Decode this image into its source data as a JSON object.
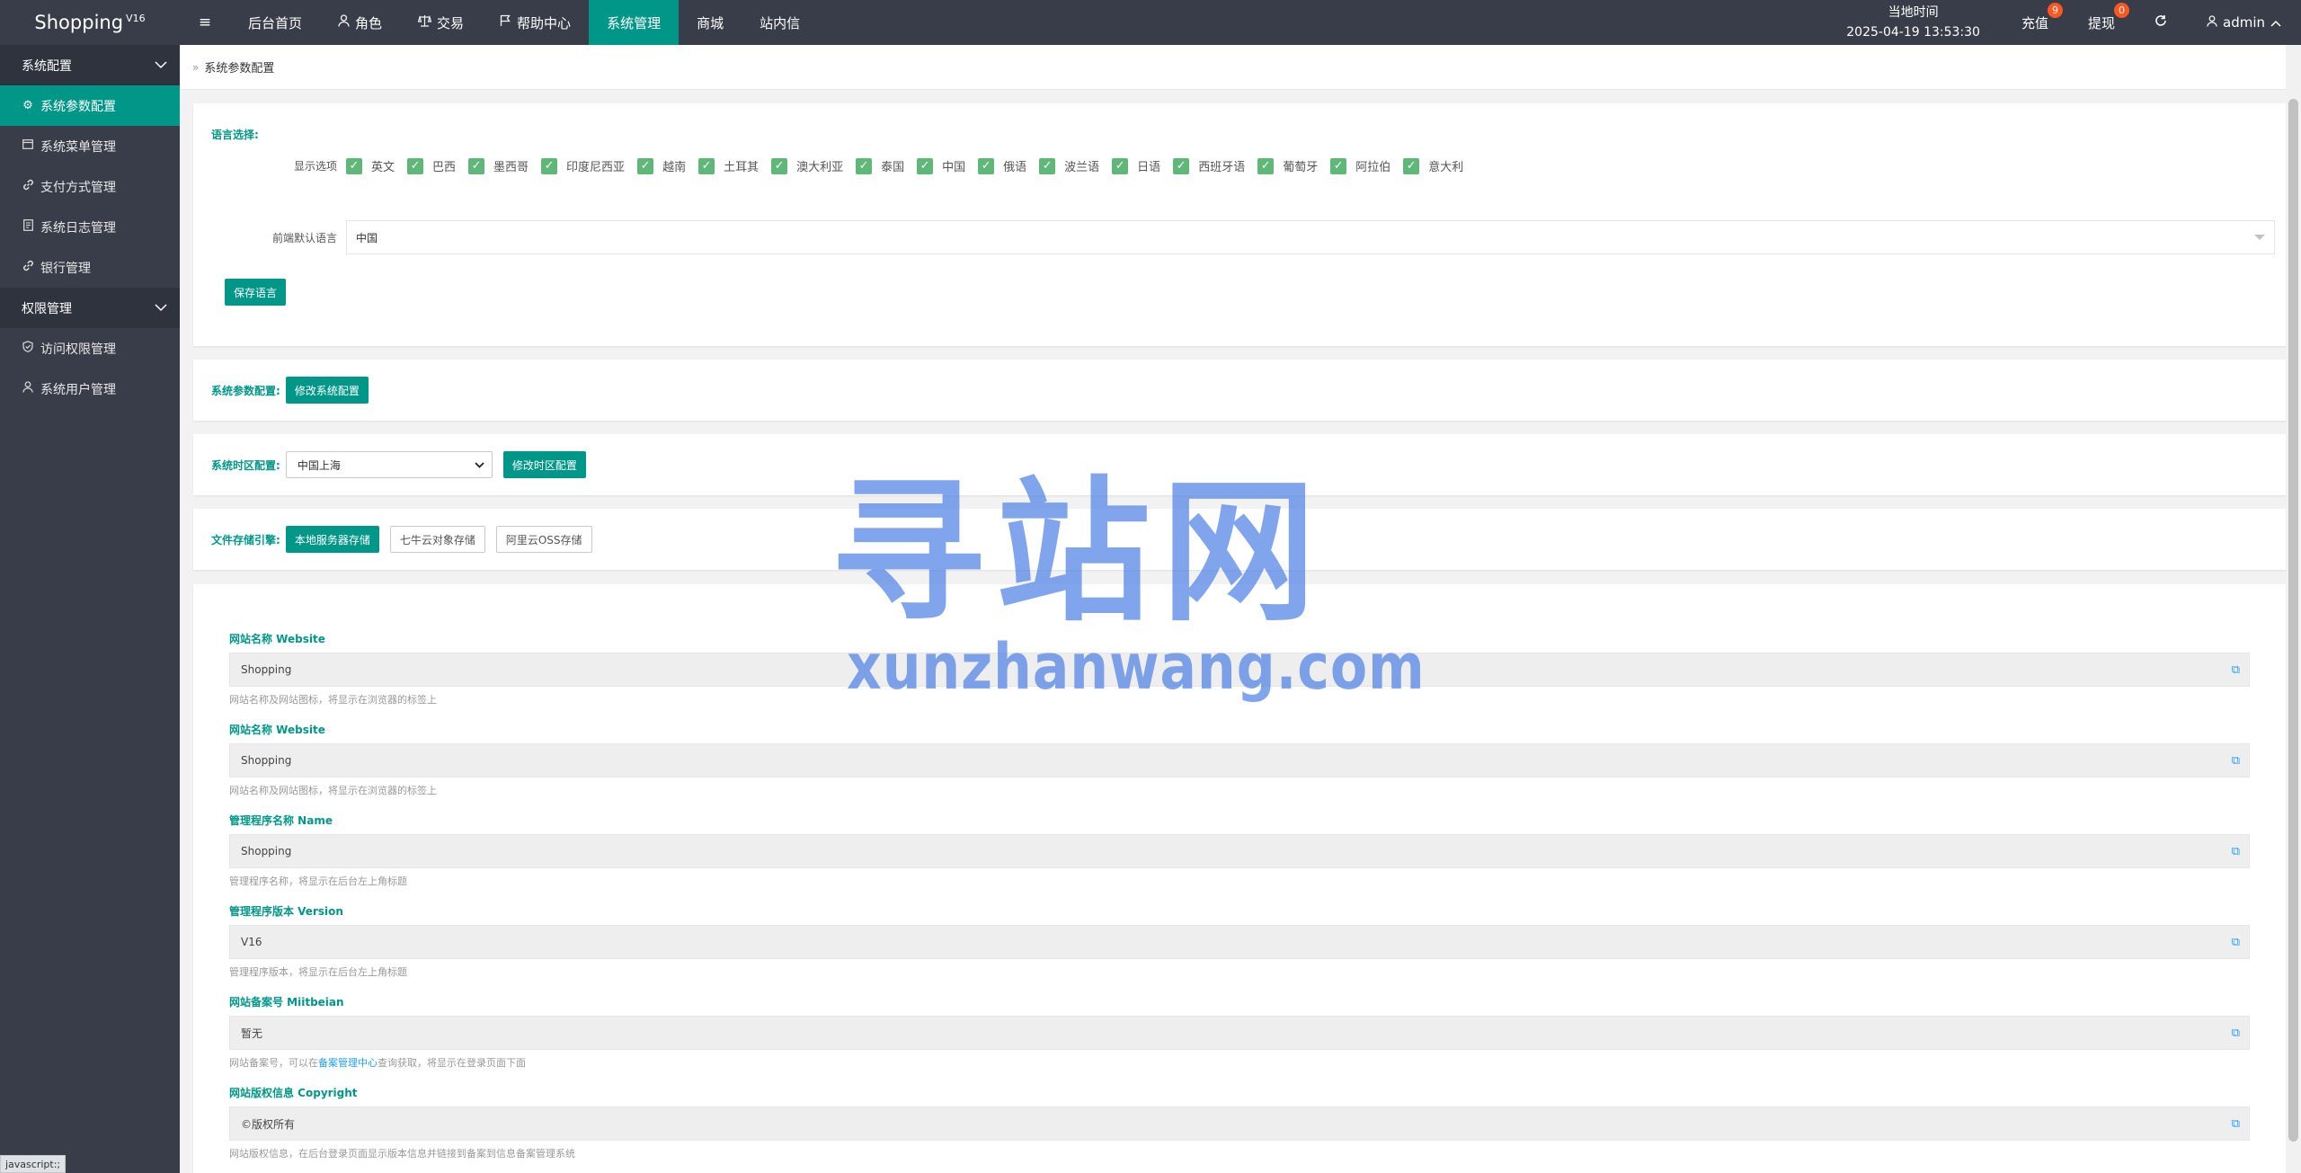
{
  "app": {
    "logo": "Shopping",
    "version_sup": "V16"
  },
  "header": {
    "toggle_icon": "≡",
    "nav": [
      {
        "label": "后台首页",
        "icon": ""
      },
      {
        "label": "角色",
        "icon": "user-icon"
      },
      {
        "label": "交易",
        "icon": "scale-icon"
      },
      {
        "label": "帮助中心",
        "icon": "flag-icon"
      },
      {
        "label": "系统管理",
        "icon": "",
        "active": true
      },
      {
        "label": "商城",
        "icon": ""
      },
      {
        "label": "站内信",
        "icon": ""
      }
    ],
    "clock_label": "当地时间",
    "clock_value": "2025-04-19 13:53:30",
    "recharge_label": "充值",
    "recharge_badge": "9",
    "withdraw_label": "提现",
    "withdraw_badge": "0",
    "refresh_icon": "refresh-icon",
    "user_label": "admin"
  },
  "sidebar": {
    "groups": [
      {
        "label": "系统配置",
        "items": [
          {
            "label": "系统参数配置",
            "icon": "gear-icon",
            "active": true
          },
          {
            "label": "系统菜单管理",
            "icon": "window-icon"
          },
          {
            "label": "支付方式管理",
            "icon": "link-icon"
          },
          {
            "label": "系统日志管理",
            "icon": "doc-icon"
          },
          {
            "label": "银行管理",
            "icon": "link-icon"
          }
        ]
      },
      {
        "label": "权限管理",
        "items": [
          {
            "label": "访问权限管理",
            "icon": "shield-check-icon"
          },
          {
            "label": "系统用户管理",
            "icon": "user-icon"
          }
        ]
      }
    ]
  },
  "breadcrumb": {
    "text": "系统参数配置"
  },
  "language": {
    "title": "语言选择:",
    "display_label": "显示选项",
    "options": [
      "英文",
      "巴西",
      "墨西哥",
      "印度尼西亚",
      "越南",
      "土耳其",
      "澳大利亚",
      "泰国",
      "中国",
      "俄语",
      "波兰语",
      "日语",
      "西班牙语",
      "葡萄牙",
      "阿拉伯",
      "意大利"
    ],
    "default_label": "前端默认语言",
    "default_value": "中国",
    "save_button": "保存语言"
  },
  "system_params": {
    "label": "系统参数配置:",
    "button": "修改系统配置"
  },
  "timezone": {
    "label": "系统时区配置:",
    "selected": "中国上海",
    "button": "修改时区配置"
  },
  "storage": {
    "label": "文件存储引擎:",
    "options": [
      "本地服务器存储",
      "七牛云对象存储",
      "阿里云OSS存储"
    ],
    "active_index": 0
  },
  "config_fields": [
    {
      "label": "网站名称 Website",
      "value": "Shopping",
      "help": "网站名称及网站图标，将显示在浏览器的标签上"
    },
    {
      "label": "网站名称 Website",
      "value": "Shopping",
      "help": "网站名称及网站图标，将显示在浏览器的标签上"
    },
    {
      "label": "管理程序名称 Name",
      "value": "Shopping",
      "help": "管理程序名称，将显示在后台左上角标题"
    },
    {
      "label": "管理程序版本 Version",
      "value": "V16",
      "help": "管理程序版本，将显示在后台左上角标题"
    },
    {
      "label": "网站备案号 Miitbeian",
      "value": "暂无",
      "help_pre": "网站备案号，可以在",
      "help_link": "备案管理中心",
      "help_post": "查询获取，将显示在登录页面下面"
    },
    {
      "label": "网站版权信息 Copyright",
      "value": "©版权所有",
      "help": "网站版权信息，在后台登录页面显示版本信息并链接到备案到信息备案管理系统"
    }
  ],
  "watermark": {
    "cn": "寻站网",
    "en": "xunzhanwang.com"
  },
  "status_bar": "javascript:;",
  "colors": {
    "header_bg": "#393d49",
    "accent": "#009688",
    "checkbox": "#5fb878",
    "badge": "#ff5722",
    "link": "#1e9fff"
  }
}
